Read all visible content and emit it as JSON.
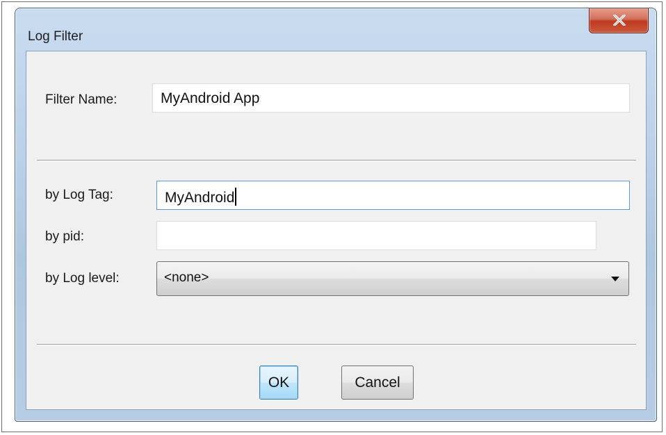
{
  "window": {
    "title": "Log Filter",
    "close_icon": "close-icon",
    "accent_color": "#c0391e"
  },
  "form": {
    "filter_name": {
      "label": "Filter Name:",
      "value": "MyAndroid App"
    },
    "log_tag": {
      "label": "by Log Tag:",
      "value": "MyAndroid"
    },
    "pid": {
      "label": "by pid:",
      "value": ""
    },
    "log_level": {
      "label": "by Log level:",
      "selected": "<none>",
      "icon": "chevron-down-icon"
    }
  },
  "buttons": {
    "ok_label": "OK",
    "cancel_label": "Cancel"
  }
}
